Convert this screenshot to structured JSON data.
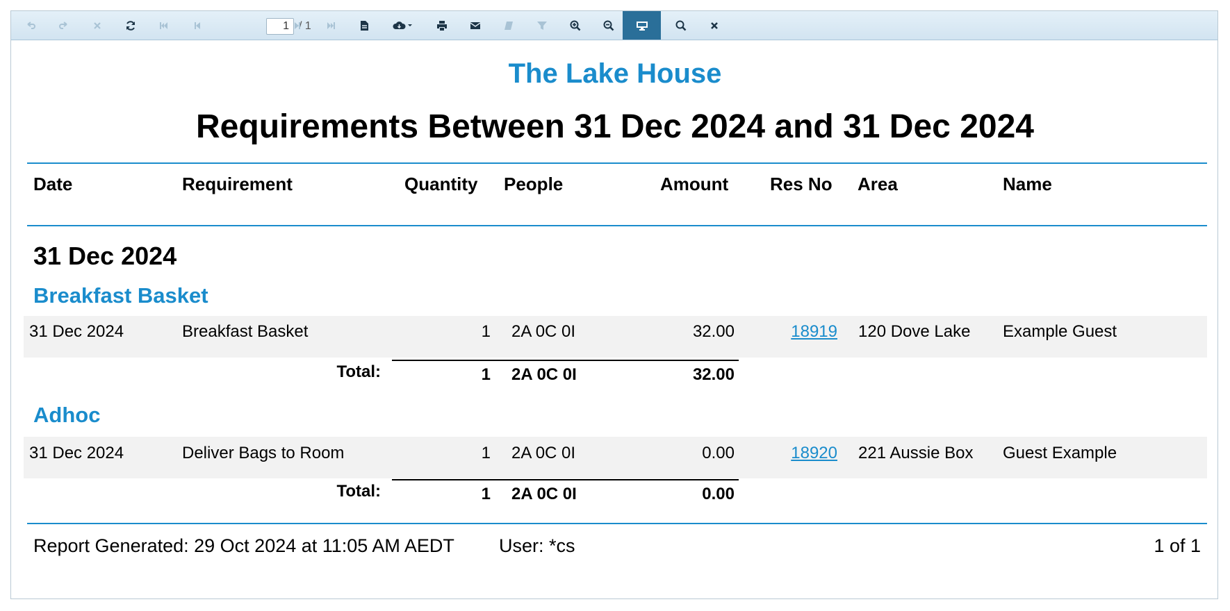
{
  "toolbar": {
    "page_current": "1",
    "page_total": "/ 1"
  },
  "report": {
    "company": "The Lake House",
    "title": "Requirements Between 31 Dec 2024 and 31 Dec 2024",
    "columns": [
      "Date",
      "Requirement",
      "Quantity",
      "People",
      "Amount",
      "Res No",
      "Area",
      "Name"
    ],
    "date_group": "31 Dec 2024",
    "groups": [
      {
        "name": "Breakfast Basket",
        "rows": [
          {
            "date": "31 Dec 2024",
            "requirement": "Breakfast Basket",
            "quantity": "1",
            "people": "2A 0C 0I",
            "amount": "32.00",
            "res_no": "18919",
            "area": "120 Dove Lake",
            "name": "Example Guest"
          }
        ],
        "total": {
          "label": "Total:",
          "quantity": "1",
          "people": "2A 0C 0I",
          "amount": "32.00"
        }
      },
      {
        "name": "Adhoc",
        "rows": [
          {
            "date": "31 Dec 2024",
            "requirement": "Deliver Bags to Room",
            "quantity": "1",
            "people": "2A 0C 0I",
            "amount": "0.00",
            "res_no": "18920",
            "area": "221 Aussie Box",
            "name": "Guest Example"
          }
        ],
        "total": {
          "label": "Total:",
          "quantity": "1",
          "people": "2A 0C 0I",
          "amount": "0.00"
        }
      }
    ],
    "footer": {
      "generated": "Report Generated: 29 Oct 2024 at 11:05 AM AEDT",
      "user": "User: *cs",
      "page": "1 of 1"
    }
  },
  "colors": {
    "accent": "#1a8ccc",
    "toolbar_active": "#2a6f99",
    "row_bg": "#f2f2f2"
  }
}
